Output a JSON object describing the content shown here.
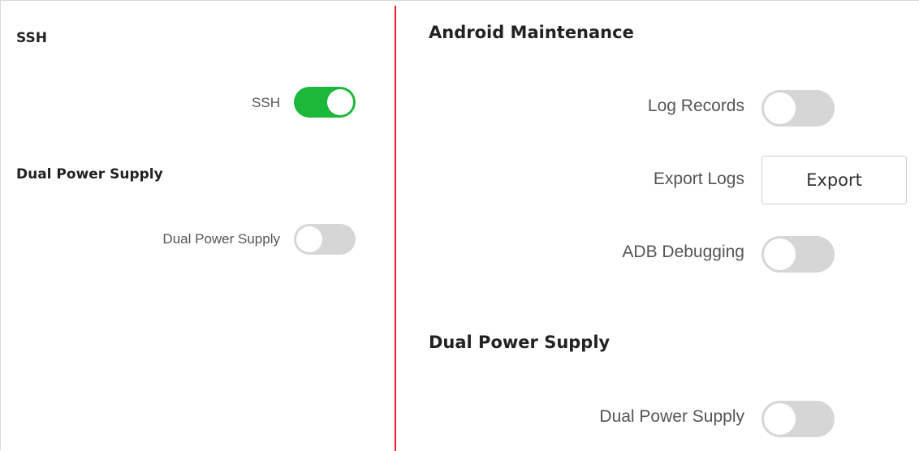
{
  "left_panel": {
    "ssh_section": {
      "title": "SSH",
      "label": "SSH",
      "toggle_on": true
    },
    "dual_power_section": {
      "title": "Dual Power Supply",
      "label": "Dual Power Supply",
      "toggle_on": false
    }
  },
  "right_panel": {
    "android_section": {
      "title": "Android Maintenance",
      "log_records": {
        "label": "Log Records",
        "toggle_on": false
      },
      "export_logs": {
        "label": "Export Logs",
        "button": "Export"
      },
      "adb_debugging": {
        "label": "ADB Debugging",
        "toggle_on": false
      }
    },
    "dual_power_section": {
      "title": "Dual Power Supply",
      "label": "Dual Power Supply",
      "toggle_on": false
    }
  },
  "colors": {
    "toggle_on": "#1cb83a",
    "toggle_off": "#d6d6d6",
    "divider": "#e8222b"
  }
}
